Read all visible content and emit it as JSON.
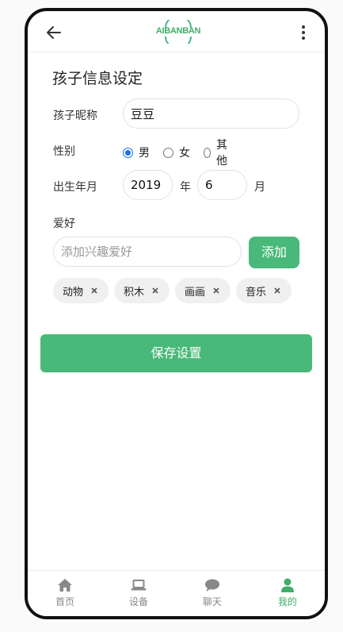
{
  "header": {
    "logo_text": "AIBANBAN",
    "back_icon": "arrow-left-icon",
    "more_icon": "more-vertical-icon"
  },
  "form": {
    "title": "孩子信息设定",
    "nickname": {
      "label": "孩子昵称",
      "value": "豆豆"
    },
    "gender": {
      "label": "性别",
      "options": [
        "男",
        "女",
        "其他"
      ],
      "selected": "男"
    },
    "birth": {
      "label": "出生年月",
      "year_value": "2019",
      "year_unit": "年",
      "month_value": "6",
      "month_unit": "月"
    },
    "hobbies": {
      "label": "爱好",
      "placeholder": "添加兴趣爱好",
      "add_label": "添加",
      "tags": [
        "动物",
        "积木",
        "画画",
        "音乐"
      ]
    },
    "save_label": "保存设置"
  },
  "nav": {
    "items": [
      {
        "label": "首页",
        "icon": "home-icon"
      },
      {
        "label": "设备",
        "icon": "laptop-icon"
      },
      {
        "label": "聊天",
        "icon": "chat-icon"
      },
      {
        "label": "我的",
        "icon": "user-icon",
        "active": true
      }
    ]
  },
  "colors": {
    "accent": "#48b978",
    "radio": "#1a73e8",
    "text": "#222222",
    "muted": "#888888"
  }
}
